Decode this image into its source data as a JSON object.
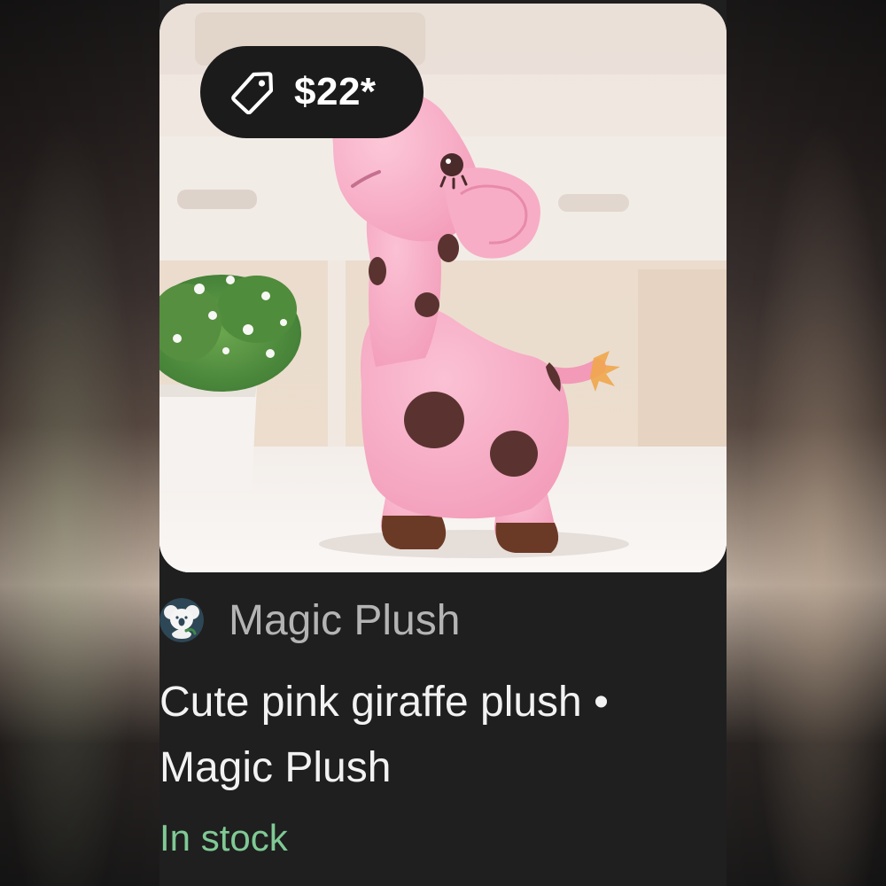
{
  "product": {
    "price": "$22*",
    "image_alt": "Cute pink giraffe plush toy",
    "merchant": {
      "name": "Magic Plush",
      "logo": "koala-logo"
    },
    "title": "Cute pink giraffe plush • Magic Plush",
    "stock": "In stock"
  },
  "icons": {
    "price": "price-tag-icon",
    "merchant": "koala-logo-icon"
  },
  "colors": {
    "card_background": "#1f1f1f",
    "pill_background": "#1b1b1b",
    "price_text": "#ffffff",
    "merchant_text": "#b4b4b4",
    "title_text": "#f2f2f2",
    "stock_text": "#80c995",
    "plush_pink": "#f4a3bf",
    "spot_brown": "#5a3330"
  }
}
